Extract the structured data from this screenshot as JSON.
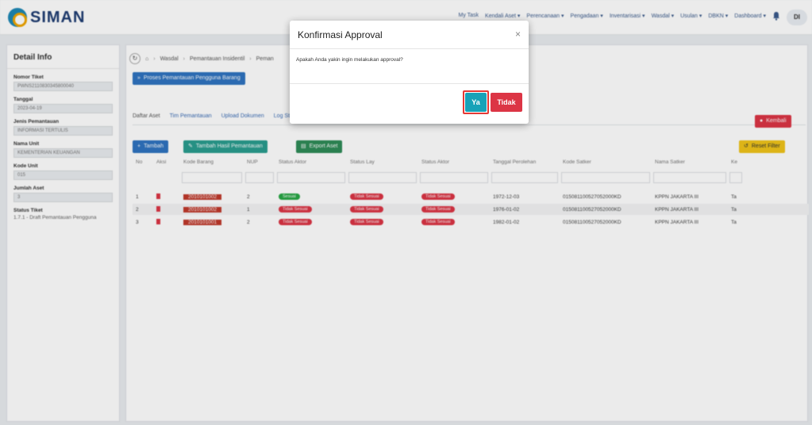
{
  "app": {
    "brand": "SIMAN"
  },
  "topmenu": [
    "My Task",
    "Kendali Aset ▾",
    "Perencanaan ▾",
    "Pengadaan ▾",
    "Inventarisasi ▾",
    "Wasdal ▾",
    "Usulan ▾",
    "DBKN ▾",
    "Dashboard ▾"
  ],
  "user": {
    "initials": "DI"
  },
  "sidebar": {
    "title": "Detail Info",
    "fields": [
      {
        "label": "Nomor Tiket",
        "value": "PWNS2110830345800040"
      },
      {
        "label": "Tanggal",
        "value": "2023-04-19"
      },
      {
        "label": "Jenis Pemantauan",
        "value": "INFORMASI TERTULIS"
      },
      {
        "label": "Nama Unit",
        "value": "KEMENTERIAN KEUANGAN"
      },
      {
        "label": "Kode Unit",
        "value": "015"
      },
      {
        "label": "Jumlah Aset",
        "value": "3"
      }
    ],
    "status_label": "Status Tiket",
    "status_value": "1.7.1 - Draft Pemantauan Pengguna"
  },
  "breadcrumb": [
    "Wasdal",
    "Pemantauan Insidentil",
    "Peman"
  ],
  "buttons": {
    "proses": "Proses Pemantauan Pengguna Barang",
    "kembali": "Kembali",
    "tambah": "Tambah",
    "tambah_hasil": "Tambah Hasil Pemantauan",
    "export": "Export Aset",
    "reset": "Reset Filter"
  },
  "tabs": [
    "Daftar Aset",
    "Tim Pemantauan",
    "Upload Dokumen",
    "Log Status"
  ],
  "table": {
    "headers": [
      "No",
      "Aksi",
      "Kode Barang",
      "NUP",
      "Status Aktor",
      "Status Lay",
      "Status Aktor",
      "Tanggal Perolehan",
      "Kode Satker",
      "Nama Satker",
      "Ke"
    ],
    "rows": [
      {
        "no": "1",
        "kode": "2010101002",
        "nup": "2",
        "s1": "Sesuai",
        "s1c": "green",
        "s2": "Tidak Sesuai",
        "s3": "Tidak Sesuai",
        "tgl": "1972-12-03",
        "kode_satker": "015081100527052000KD",
        "nama_satker": "KPPN JAKARTA III",
        "ke": "Ta"
      },
      {
        "no": "2",
        "kode": "2010101002",
        "nup": "1",
        "s1": "Tidak Sesuai",
        "s1c": "red",
        "s2": "Tidak Sesuai",
        "s3": "Tidak Sesuai",
        "tgl": "1976-01-02",
        "kode_satker": "015081100527052000KD",
        "nama_satker": "KPPN JAKARTA III",
        "ke": "Ta"
      },
      {
        "no": "3",
        "kode": "2010101001",
        "nup": "2",
        "s1": "Tidak Sesuai",
        "s1c": "red",
        "s2": "Tidak Sesuai",
        "s3": "Tidak Sesuai",
        "tgl": "1982-01-02",
        "kode_satker": "015081100527052000KD",
        "nama_satker": "KPPN JAKARTA III",
        "ke": "Ta"
      }
    ]
  },
  "modal": {
    "title": "Konfirmasi Approval",
    "close": "×",
    "message": "Apakah Anda yakin ingin melakukan approval?",
    "yes": "Ya",
    "no": "Tidak"
  }
}
